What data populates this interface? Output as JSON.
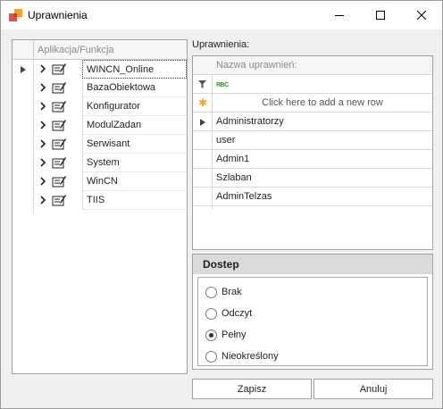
{
  "window": {
    "title": "Uprawnienia"
  },
  "left_panel": {
    "header": "Aplikacja/Funkcja",
    "items": [
      {
        "label": "WINCN_Online"
      },
      {
        "label": "BazaObiektowa"
      },
      {
        "label": "Konfigurator"
      },
      {
        "label": "ModulZadan"
      },
      {
        "label": "Serwisant"
      },
      {
        "label": "System"
      },
      {
        "label": "WinCN"
      },
      {
        "label": "TIIS"
      }
    ]
  },
  "rights": {
    "caption": "Uprawnienia:",
    "column_header": "Nazwa uprawnień:",
    "filter_icon_text": "RBC",
    "new_row_text": "Click here to add a new row",
    "rows": [
      {
        "name": "Administratorzy"
      },
      {
        "name": "user"
      },
      {
        "name": "Admin1"
      },
      {
        "name": "Szlaban"
      },
      {
        "name": "AdminTelzas"
      }
    ]
  },
  "access": {
    "title": "Dostep",
    "options": [
      {
        "label": "Brak",
        "selected": false
      },
      {
        "label": "Odczyt",
        "selected": false
      },
      {
        "label": "Pełny",
        "selected": true
      },
      {
        "label": "Nieokreślony",
        "selected": false
      }
    ]
  },
  "buttons": {
    "save": "Zapisz",
    "cancel": "Anuluj"
  },
  "colors": {
    "border": "#a0a0a0",
    "group_header": "#dadada",
    "new_row_star": "#f5a623"
  }
}
